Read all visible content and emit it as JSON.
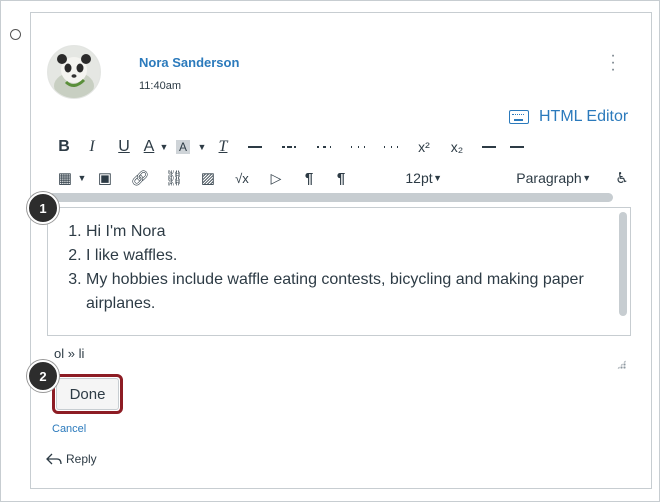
{
  "post": {
    "author": "Nora Sanderson",
    "time": "11:40am",
    "menu_icon": "more-vertical-icon"
  },
  "editor_toggle": {
    "label": "HTML Editor",
    "icon": "keyboard-icon"
  },
  "toolbar": {
    "bold": "B",
    "italic": "I",
    "underline": "U",
    "text_color": "A",
    "highlight": "A",
    "clear_format": "T",
    "superscript": "x²",
    "subscript": "x₂",
    "math": "√x",
    "font_size": "12pt",
    "block_format": "Paragraph"
  },
  "content": {
    "items": [
      "Hi I'm Nora",
      "I like waffles.",
      "My hobbies include waffle eating contests, bicycling and making paper airplanes."
    ]
  },
  "status_path": "ol » li",
  "actions": {
    "done": "Done",
    "cancel": "Cancel",
    "reply": "Reply"
  },
  "callouts": {
    "one": "1",
    "two": "2"
  },
  "colors": {
    "link": "#2b7abc",
    "highlight_border": "#8d1c24",
    "badge": "#2d2d2d"
  }
}
